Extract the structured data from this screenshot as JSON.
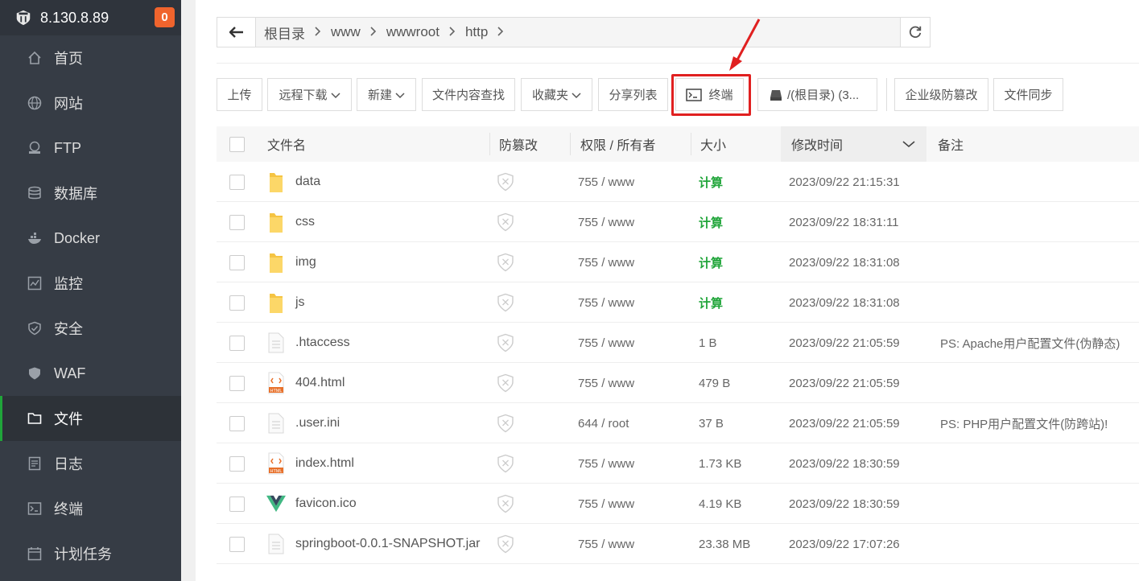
{
  "server": {
    "ip": "8.130.8.89",
    "badge_count": "0"
  },
  "sidebar": {
    "items": [
      {
        "label": "首页",
        "icon": "home-icon"
      },
      {
        "label": "网站",
        "icon": "globe-icon"
      },
      {
        "label": "FTP",
        "icon": "ftp-icon"
      },
      {
        "label": "数据库",
        "icon": "database-icon"
      },
      {
        "label": "Docker",
        "icon": "docker-icon"
      },
      {
        "label": "监控",
        "icon": "monitor-icon"
      },
      {
        "label": "安全",
        "icon": "shield-icon"
      },
      {
        "label": "WAF",
        "icon": "waf-icon"
      },
      {
        "label": "文件",
        "icon": "folder-icon",
        "active": true
      },
      {
        "label": "日志",
        "icon": "log-icon"
      },
      {
        "label": "终端",
        "icon": "terminal-icon"
      },
      {
        "label": "计划任务",
        "icon": "calendar-icon"
      }
    ]
  },
  "breadcrumb": [
    "根目录",
    "www",
    "wwwroot",
    "http"
  ],
  "toolbar": {
    "upload": "上传",
    "remote_download": "远程下载",
    "new": "新建",
    "content_search": "文件内容查找",
    "favorites": "收藏夹",
    "share_list": "分享列表",
    "terminal": "终端",
    "disk": "/(根目录) (3...",
    "enterprise_protect": "企业级防篡改",
    "file_sync": "文件同步"
  },
  "table": {
    "headers": {
      "name": "文件名",
      "protect": "防篡改",
      "perm": "权限 / 所有者",
      "size": "大小",
      "mtime": "修改时间",
      "note": "备注"
    },
    "rows": [
      {
        "name": "data",
        "type": "folder",
        "perm": "755 / www",
        "size": "计算",
        "size_is_calc": true,
        "mtime": "2023/09/22 21:15:31",
        "note": ""
      },
      {
        "name": "css",
        "type": "folder",
        "perm": "755 / www",
        "size": "计算",
        "size_is_calc": true,
        "mtime": "2023/09/22 18:31:11",
        "note": ""
      },
      {
        "name": "img",
        "type": "folder",
        "perm": "755 / www",
        "size": "计算",
        "size_is_calc": true,
        "mtime": "2023/09/22 18:31:08",
        "note": ""
      },
      {
        "name": "js",
        "type": "folder",
        "perm": "755 / www",
        "size": "计算",
        "size_is_calc": true,
        "mtime": "2023/09/22 18:31:08",
        "note": ""
      },
      {
        "name": ".htaccess",
        "type": "file",
        "perm": "755 / www",
        "size": "1 B",
        "size_is_calc": false,
        "mtime": "2023/09/22 21:05:59",
        "note": "PS: Apache用户配置文件(伪静态)"
      },
      {
        "name": "404.html",
        "type": "html",
        "perm": "755 / www",
        "size": "479 B",
        "size_is_calc": false,
        "mtime": "2023/09/22 21:05:59",
        "note": ""
      },
      {
        "name": ".user.ini",
        "type": "file",
        "perm": "644 / root",
        "size": "37 B",
        "size_is_calc": false,
        "mtime": "2023/09/22 21:05:59",
        "note": "PS: PHP用户配置文件(防跨站)!"
      },
      {
        "name": "index.html",
        "type": "html",
        "perm": "755 / www",
        "size": "1.73 KB",
        "size_is_calc": false,
        "mtime": "2023/09/22 18:30:59",
        "note": ""
      },
      {
        "name": "favicon.ico",
        "type": "vue",
        "perm": "755 / www",
        "size": "4.19 KB",
        "size_is_calc": false,
        "mtime": "2023/09/22 18:30:59",
        "note": ""
      },
      {
        "name": "springboot-0.0.1-SNAPSHOT.jar",
        "type": "file",
        "perm": "755 / www",
        "size": "23.38 MB",
        "size_is_calc": false,
        "mtime": "2023/09/22 17:07:26",
        "note": ""
      }
    ]
  },
  "colors": {
    "sidebar_bg": "#363c45",
    "accent_green": "#20a53a",
    "badge_orange": "#f0642d",
    "highlight_red": "#e02020"
  }
}
